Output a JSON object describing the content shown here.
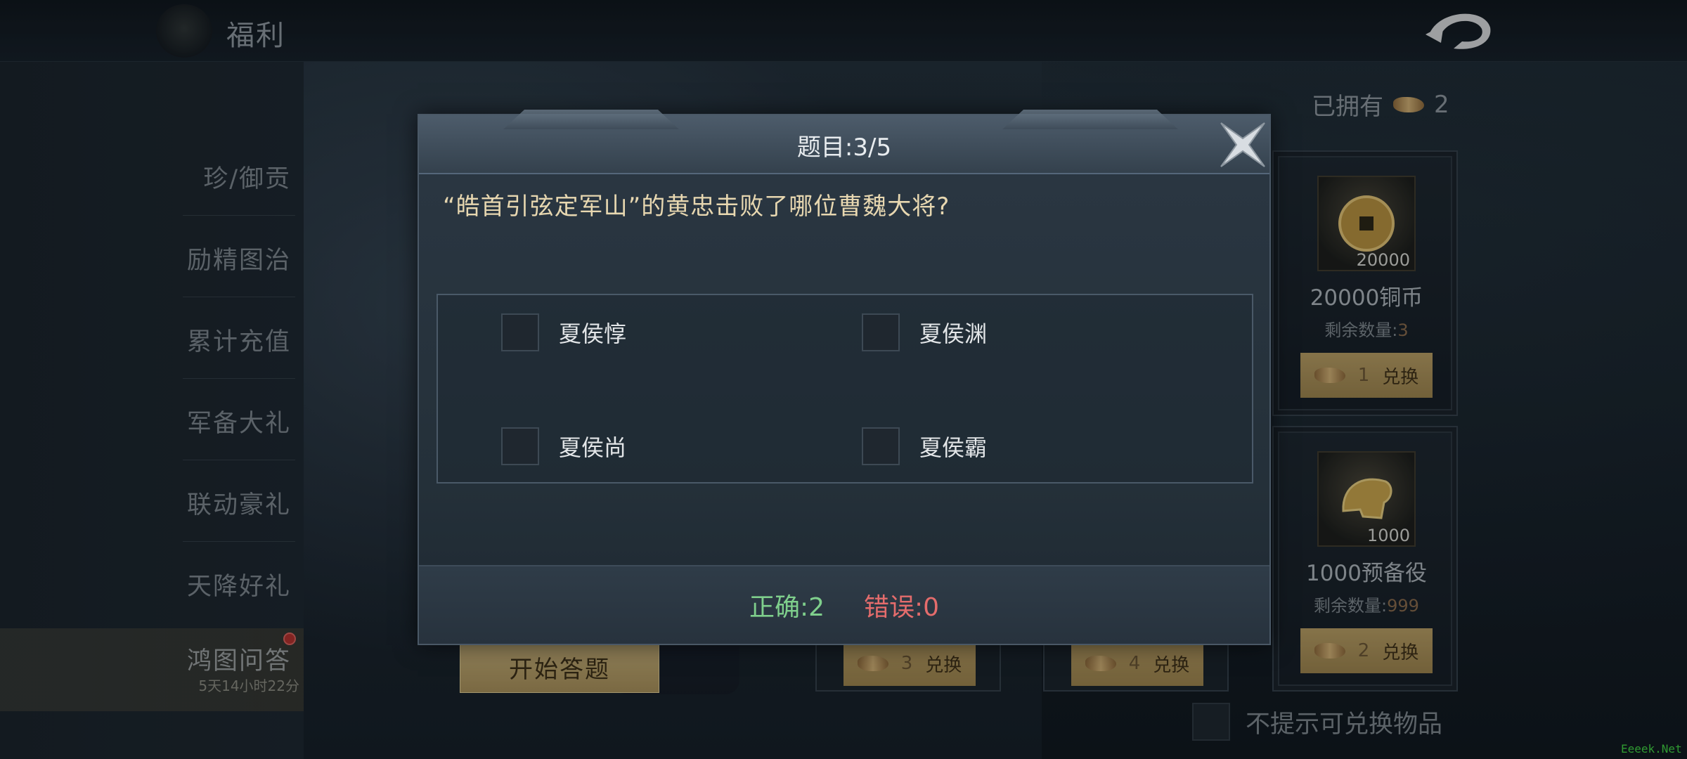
{
  "header": {
    "title": "福利"
  },
  "sidebar": {
    "items": [
      {
        "label": "珍/御贡"
      },
      {
        "label": "励精图治"
      },
      {
        "label": "累计充值"
      },
      {
        "label": "军备大礼"
      },
      {
        "label": "联动豪礼"
      },
      {
        "label": "天降好礼"
      },
      {
        "label": "鸿图问答",
        "timer": "5天14小时22分",
        "active": true
      }
    ]
  },
  "main": {
    "start_button": "开始答题",
    "owned": {
      "label": "已拥有",
      "count": "2"
    },
    "rewards": [
      {
        "qty": "20000",
        "name": "20000铜币",
        "remaining_label": "剩余数量:",
        "remaining": "3",
        "cost": "1",
        "action": "兑换",
        "icon": "copper-coin-icon"
      },
      {
        "qty": "1000",
        "name": "1000预备役",
        "remaining_label": "剩余数量:",
        "remaining": "999",
        "cost": "2",
        "action": "兑换",
        "icon": "helmet-icon"
      }
    ],
    "hidden_rewards": [
      {
        "cost": "3",
        "action": "兑换"
      },
      {
        "cost": "4",
        "action": "兑换"
      }
    ],
    "no_remind_label": "不提示可兑换物品"
  },
  "quiz": {
    "title": "题目:3/5",
    "question": "“皓首引弦定军山”的黄忠击败了哪位曹魏大将?",
    "options": [
      "夏侯惇",
      "夏侯渊",
      "夏侯尚",
      "夏侯霸"
    ],
    "score": {
      "correct": "正确:2",
      "wrong": "错误:0"
    }
  },
  "watermark": "Eeeek.Net",
  "colors": {
    "correct": "#7fcf8c",
    "wrong": "#e46c6c",
    "question": "#e7d7b0",
    "gold_button": "#c9b27a"
  }
}
